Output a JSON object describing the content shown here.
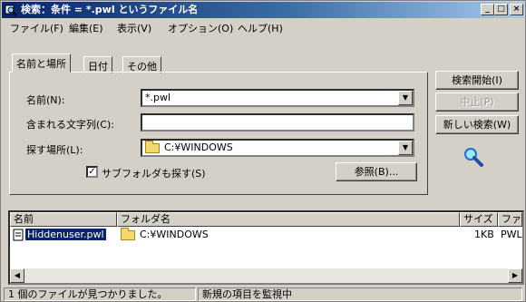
{
  "window": {
    "title": "検索：条件 = *.pwl というファイル名",
    "minimize_label": "_",
    "maximize_label": "□",
    "close_label": "×"
  },
  "menu": [
    "ファイル(F)",
    "編集(E)",
    "表示(V)",
    "オプション(O)",
    "ヘルプ(H)"
  ],
  "tabs": [
    "名前と場所",
    "日付",
    "その他"
  ],
  "form": {
    "name_label": "名前(N):",
    "name_value": "*.pwl",
    "contains_label": "含まれる文字列(C):",
    "contains_value": "",
    "lookin_label": "探す場所(L):",
    "lookin_value": "C:¥WINDOWS",
    "subfolders_label": "サブフォルダも探す(S)",
    "subfolders_checked": "✓",
    "browse_label": "参照(B)..."
  },
  "buttons": {
    "find_now": "検索開始(I)",
    "stop": "中止(P)",
    "new_search": "新しい検索(W)"
  },
  "results": {
    "columns": [
      "名前",
      "フォルダ名",
      "サイズ",
      "ファイル"
    ],
    "rows": [
      {
        "name": "Hiddenuser.pwl",
        "folder": "C:¥WINDOWS",
        "size": "1KB",
        "type": "PWL フ"
      }
    ]
  },
  "status": {
    "left": "1 個のファイルが見つかりました。",
    "right": "新規の項目を監視中"
  },
  "icons": {
    "app": "search-window-icon",
    "magnifier": "magnifier-icon",
    "folder": "folder-icon",
    "file": "pwl-file-icon"
  },
  "colors": {
    "titlebar_start": "#08246b",
    "titlebar_end": "#a6caf0",
    "face": "#d4d0c8",
    "selection": "#0a246a"
  }
}
